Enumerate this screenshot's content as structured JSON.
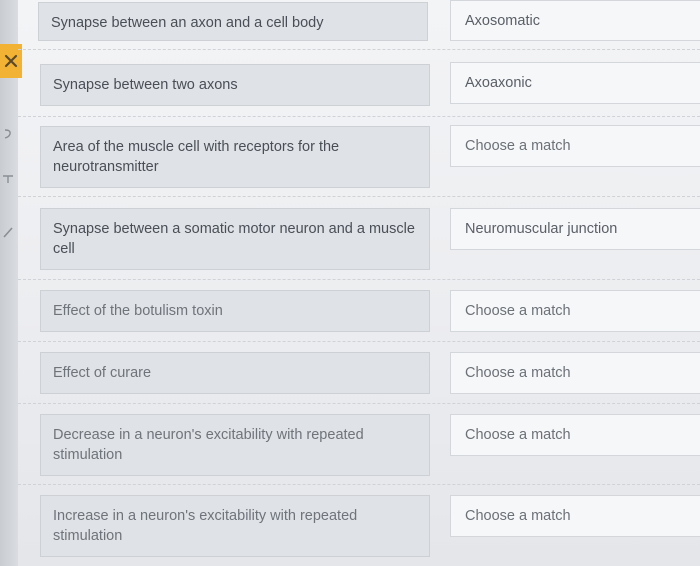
{
  "rows": [
    {
      "prompt": "Synapse between an axon and a cell body",
      "match": "Axosomatic"
    },
    {
      "prompt": "Synapse between two axons",
      "match": "Axoaxonic"
    },
    {
      "prompt": "Area of the muscle cell with receptors for the neurotransmitter",
      "match": "Choose a match"
    },
    {
      "prompt": "Synapse between a somatic motor neuron and a muscle cell",
      "match": "Neuromuscular junction"
    },
    {
      "prompt": "Effect of the botulism toxin",
      "match": "Choose a match"
    },
    {
      "prompt": "Effect of curare",
      "match": "Choose a match"
    },
    {
      "prompt": "Decrease in a neuron's excitability with repeated stimulation",
      "match": "Choose a match"
    },
    {
      "prompt": "Increase in a neuron's excitability with repeated stimulation",
      "match": "Choose a match"
    }
  ],
  "icons": {
    "close": "close-icon"
  },
  "colors": {
    "close_tab": "#f2b233",
    "prompt_bg": "#dfe2e6",
    "match_bg": "#f6f7f8"
  }
}
